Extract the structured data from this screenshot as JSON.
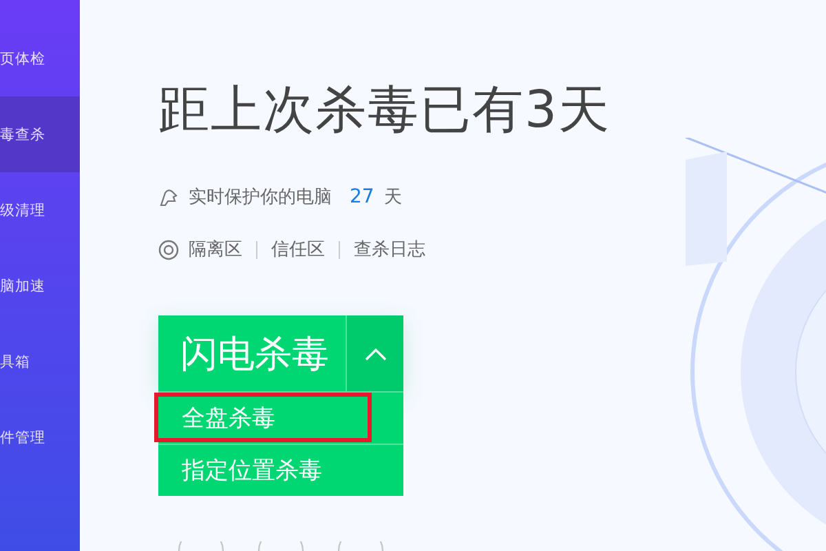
{
  "sidebar": {
    "items": [
      {
        "label": "页体检",
        "selected": false
      },
      {
        "label": "毒查杀",
        "selected": true
      },
      {
        "label": "级清理",
        "selected": false
      },
      {
        "label": "脑加速",
        "selected": false
      },
      {
        "label": "具箱",
        "selected": false
      },
      {
        "label": "件管理",
        "selected": false
      }
    ]
  },
  "main": {
    "title": "距上次杀毒已有3天",
    "protection": {
      "text": "实时保护你的电脑",
      "days": "27",
      "unit": "天"
    },
    "links": [
      "隔离区",
      "信任区",
      "查杀日志"
    ],
    "scan_button": {
      "label": "闪电杀毒",
      "expanded": true
    },
    "menu": [
      {
        "label": "全盘杀毒",
        "highlighted": true
      },
      {
        "label": "指定位置杀毒",
        "highlighted": false
      }
    ],
    "bottom_icons": [
      {
        "kind": "circle"
      },
      {
        "kind": "circle"
      },
      {
        "kind": "circle"
      }
    ]
  }
}
